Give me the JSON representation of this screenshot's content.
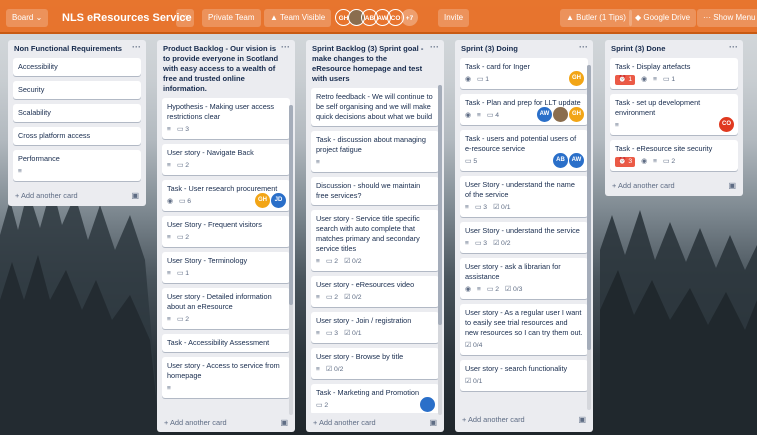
{
  "topbar": {
    "board_menu_label": "Board ⌄",
    "board_title": "NLS eResources Service",
    "visibility_label": "Private Team",
    "team_visible_label": "Team Visible",
    "extra_members": "+7",
    "invite_label": "Invite",
    "butler_label": "Butler (1 Tips)",
    "google_drive_label": "Google Drive",
    "show_menu_label": "Show Menu",
    "members": [
      {
        "initials": "GH",
        "color": "#f2a516"
      },
      {
        "initials": "",
        "color": "#8a6d4e"
      },
      {
        "initials": "AB",
        "color": "#2a6fc9"
      },
      {
        "initials": "AW",
        "color": "#2a6fc9"
      },
      {
        "initials": "CO",
        "color": "#e0391f"
      }
    ]
  },
  "lists": [
    {
      "title": "Non Functional Requirements",
      "cards": [
        {
          "title": "Accessibility"
        },
        {
          "title": "Security"
        },
        {
          "title": "Scalability"
        },
        {
          "title": "Cross platform access"
        },
        {
          "title": "Performance",
          "desc": true
        }
      ],
      "add_label": "+ Add another card"
    },
    {
      "title": "Product Backlog - Our vision is to provide everyone in Scotland with easy access to a wealth of free and trusted online information.",
      "cards": [
        {
          "title": "Hypothesis - Making user access restrictions clear",
          "comments": "3",
          "desc": true
        },
        {
          "title": "User story - Navigate Back",
          "comments": "2",
          "desc": true
        },
        {
          "title": "Task - User research procurement",
          "watch": true,
          "comments": "6",
          "members": [
            {
              "initials": "GH",
              "color": "#f2a516"
            },
            {
              "initials": "JD",
              "color": "#2a6fc9"
            }
          ]
        },
        {
          "title": "User Story - Frequent visitors",
          "comments": "2",
          "desc": true
        },
        {
          "title": "User Story - Terminology",
          "comments": "1",
          "desc": true
        },
        {
          "title": "User story - Detailed information about an eResource",
          "comments": "2",
          "desc": true
        },
        {
          "title": "Task - Accessibility Assessment"
        },
        {
          "title": "User story - Access to service from homepage",
          "desc": true
        }
      ],
      "add_label": "+ Add another card"
    },
    {
      "title": "Sprint Backlog (3) Sprint goal - make changes to the eResource homepage and test with users",
      "cards": [
        {
          "title": "Retro feedback - We will continue to be self organising and we will make quick decisions about what we build"
        },
        {
          "title": "Task - discussion about managing project fatigue",
          "desc": true
        },
        {
          "title": "Discussion - should we maintain free services?"
        },
        {
          "title": "User story - Service title specific search with auto complete that matches primary and secondary service titles",
          "desc": true,
          "comments": "2",
          "checklist": "0/2"
        },
        {
          "title": "User story - eResources video",
          "desc": true,
          "comments": "2",
          "checklist": "0/2"
        },
        {
          "title": "User story - Join / registration",
          "desc": true,
          "comments": "3",
          "checklist": "0/1"
        },
        {
          "title": "User story - Browse by title",
          "desc": true,
          "checklist": "0/2"
        },
        {
          "title": "Task - Marketing and Promotion",
          "comments": "2",
          "members": [
            {
              "initials": "",
              "color": "#2a6fc9"
            }
          ]
        }
      ],
      "add_label": "+ Add another card"
    },
    {
      "title": "Sprint (3) Doing",
      "cards": [
        {
          "title": "Task - card for Inger",
          "watch": true,
          "comments": "1",
          "members": [
            {
              "initials": "GH",
              "color": "#f2a516"
            }
          ]
        },
        {
          "title": "Task - Plan and prep for LLT update",
          "watch": true,
          "desc": true,
          "comments": "4",
          "members": [
            {
              "initials": "AW",
              "color": "#2a6fc9"
            },
            {
              "initials": "",
              "color": "#8a6d4e"
            },
            {
              "initials": "GH",
              "color": "#f2a516"
            }
          ]
        },
        {
          "title": "Task - users and potential users of e-resource service",
          "comments": "5",
          "members": [
            {
              "initials": "AB",
              "color": "#2a6fc9"
            },
            {
              "initials": "AW",
              "color": "#2a6fc9"
            }
          ]
        },
        {
          "title": "User Story - understand the name of the service",
          "desc": true,
          "comments": "3",
          "checklist": "0/1"
        },
        {
          "title": "User Story - understand the service",
          "desc": true,
          "comments": "3",
          "checklist": "0/2"
        },
        {
          "title": "User story - ask a librarian for assistance",
          "watch": true,
          "desc": true,
          "comments": "2",
          "checklist": "0/3"
        },
        {
          "title": "User story - As a regular user I want to easily see trial resources and new resources so I can try them out.",
          "checklist": "0/4"
        },
        {
          "title": "User story - search functionality",
          "checklist": "0/1"
        }
      ],
      "add_label": "+ Add another card"
    },
    {
      "title": "Sprint (3) Done",
      "cards": [
        {
          "title": "Task - Display artefacts",
          "red_badge": "1",
          "watch": true,
          "desc": true,
          "comments": "1"
        },
        {
          "title": "Task - set up development environment",
          "desc": true,
          "members": [
            {
              "initials": "CO",
              "color": "#e0391f"
            }
          ]
        },
        {
          "title": "Task - eResource site security",
          "red_badge": "3",
          "watch": true,
          "desc": true,
          "comments": "2"
        }
      ],
      "add_label": "+ Add another card"
    }
  ]
}
